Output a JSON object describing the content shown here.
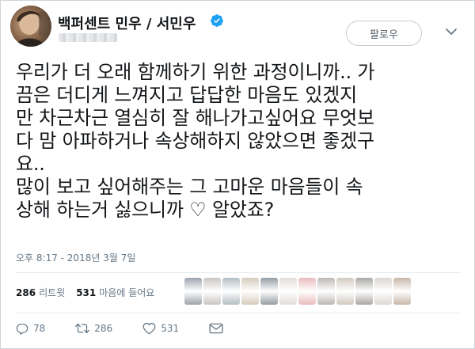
{
  "author": {
    "display_name": "백퍼센트 민우 / 서민우",
    "verified": true,
    "handle_redacted": true
  },
  "follow_button": {
    "label": "팔로우"
  },
  "tweet": {
    "text": "우리가 더 오래 함께하기 위한 과정이니까.. 가\n끔은 더디게 느껴지고 답답한 마음도 있겠지\n만 차근차근 열심히 잘 해나가고싶어요 무엇보\n다 맘 아파하거나 속상해하지 않았으면 좋겠구\n요..\n많이 보고 싶어해주는 그 고마운 마음들이 속\n상해 하는거 싫으니까 ♡ 알았죠?",
    "timestamp": "오후 8:17 - 2018년 3월 7일"
  },
  "stats": {
    "retweets_count": "286",
    "retweets_label": "리트윗",
    "likes_count": "531",
    "likes_label": "마음에 들어요"
  },
  "liker_avatars": [
    {
      "color": "#7c8590"
    },
    {
      "color": "#b7b3ad"
    },
    {
      "color": "#9aa8b0"
    },
    {
      "color": "#c7b9a4"
    },
    {
      "color": "#6f7a84"
    },
    {
      "color": "#d8d3cc"
    },
    {
      "color": "#e3a4a8"
    },
    {
      "color": "#a4a09b"
    },
    {
      "color": "#c2b7aa"
    },
    {
      "color": "#8d8a86"
    },
    {
      "color": "#d0cac2"
    },
    {
      "color": "#b59e8c"
    }
  ],
  "actions": {
    "reply_count": "78",
    "retweet_count": "286",
    "like_count": "531"
  },
  "colors": {
    "verified": "#1da1f2",
    "muted": "#657786",
    "text": "#14171a"
  }
}
